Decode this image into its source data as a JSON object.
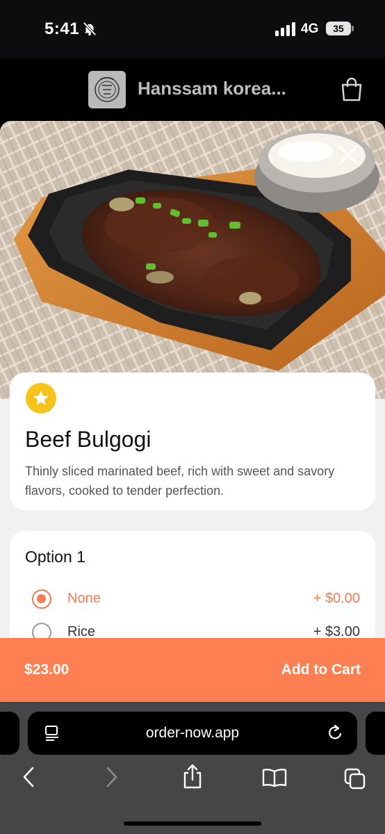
{
  "status_bar": {
    "time": "5:41",
    "network": "4G",
    "battery": "35"
  },
  "header": {
    "restaurant_name": "Hanssam korea...",
    "logo_icon": "restaurant-logo",
    "cart_icon": "shopping-bag-icon"
  },
  "item": {
    "title": "Beef Bulgogi",
    "description": "Thinly sliced marinated beef, rich with sweet and savory flavors, cooked to tender perfection.",
    "badge_icon": "star-icon"
  },
  "options": {
    "title": "Option 1",
    "choices": [
      {
        "label": "None",
        "price": "+ $0.00",
        "selected": true
      },
      {
        "label": "Rice",
        "price": "+ $3.00",
        "selected": false
      }
    ]
  },
  "cart_bar": {
    "total": "$23.00",
    "action": "Add to Cart"
  },
  "browser": {
    "url": "order-now.app"
  },
  "colors": {
    "accent": "#fd7f52",
    "badge": "#f7c21a"
  }
}
